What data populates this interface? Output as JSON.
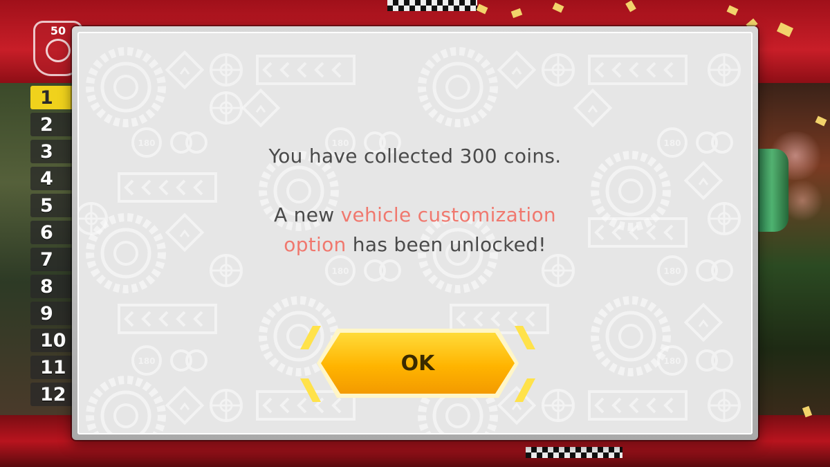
{
  "hud": {
    "speed_class": "50",
    "ranks": [
      "1",
      "2",
      "3",
      "4",
      "5",
      "6",
      "7",
      "8",
      "9",
      "10",
      "11",
      "12"
    ],
    "current_rank_index": 0
  },
  "dialog": {
    "line1": "You have collected 300 coins.",
    "line2_prefix": "A new ",
    "line2_highlight_a": "vehicle customization",
    "line2_highlight_b": "option",
    "line2_suffix": " has been unlocked!",
    "ok_label": "OK"
  },
  "colors": {
    "highlight_text": "#f0786e",
    "button_gold": "#ffb400",
    "rank_highlight": "#f0d21c"
  },
  "icons": [
    "speed-badge-icon",
    "tire-icon",
    "road-sign-icon",
    "chevron-arrows-icon",
    "coin-icon",
    "trophy-icon"
  ]
}
